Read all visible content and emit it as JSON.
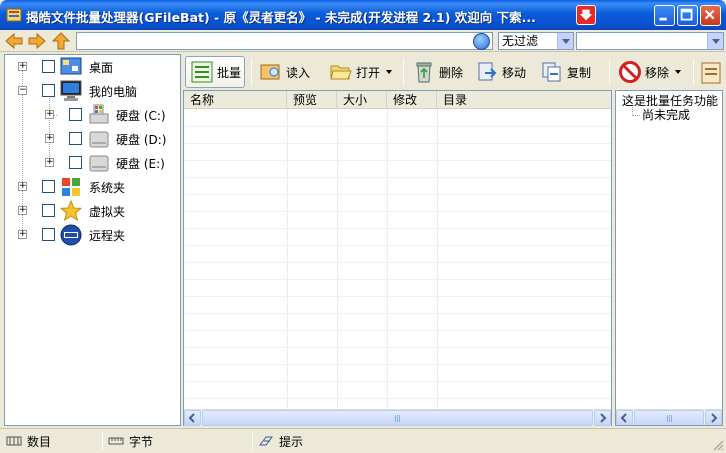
{
  "window": {
    "title": "揭皓文件批量处理器(GFileBat) - 原《灵者更名》 - 未完成(开发进程 2.1) 欢迎向 下索..."
  },
  "address": {
    "path_value": "",
    "filter_value": "无过滤",
    "search_value": ""
  },
  "tree": {
    "items": [
      {
        "label": "桌面",
        "icon": "desktop-icon"
      },
      {
        "label": "我的电脑",
        "icon": "computer-icon"
      },
      {
        "label": "硬盘 (C:)",
        "icon": "drive-icon"
      },
      {
        "label": "硬盘 (D:)",
        "icon": "drive-icon"
      },
      {
        "label": "硬盘 (E:)",
        "icon": "drive-icon"
      },
      {
        "label": "系统夹",
        "icon": "windows-icon"
      },
      {
        "label": "虚拟夹",
        "icon": "star-icon"
      },
      {
        "label": "远程夹",
        "icon": "ftp-icon"
      }
    ]
  },
  "toolbar": {
    "batch_label": "批量",
    "read_label": "读入",
    "open_label": "打开",
    "delete_label": "删除",
    "move_label": "移动",
    "copy_label": "复制",
    "remove_label": "移除"
  },
  "filelist": {
    "columns": [
      "名称",
      "预览",
      "大小",
      "修改",
      "目录"
    ]
  },
  "rightpanel": {
    "line1": "这是批量任务功能",
    "line2": "尚未完成"
  },
  "statusbar": {
    "count_label": "数目",
    "bytes_label": "字节",
    "hint_label": "提示"
  },
  "colors": {
    "titlebar": "#0b5bd8",
    "window_bg": "#ece9d8",
    "border": "#7f9db9"
  }
}
